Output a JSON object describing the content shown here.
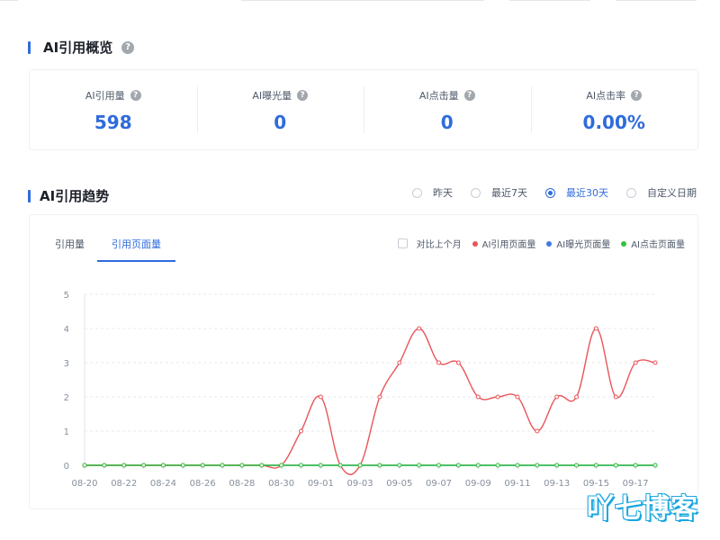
{
  "overview": {
    "title": "AI引用概览",
    "metrics": [
      {
        "label": "AI引用量",
        "value": "598"
      },
      {
        "label": "AI曝光量",
        "value": "0"
      },
      {
        "label": "AI点击量",
        "value": "0"
      },
      {
        "label": "AI点击率",
        "value": "0.00%"
      }
    ]
  },
  "trend": {
    "title": "AI引用趋势",
    "range_options": [
      {
        "label": "昨天",
        "selected": false
      },
      {
        "label": "最近7天",
        "selected": false
      },
      {
        "label": "最近30天",
        "selected": true
      },
      {
        "label": "自定义日期",
        "selected": false
      }
    ],
    "tabs": [
      {
        "label": "引用量",
        "active": false
      },
      {
        "label": "引用页面量",
        "active": true
      }
    ],
    "compare_label": "对比上个月",
    "legend": [
      {
        "name": "AI引用页面量",
        "color": "#e8555a"
      },
      {
        "name": "AI曝光页面量",
        "color": "#3f7ae0"
      },
      {
        "name": "AI点击页面量",
        "color": "#34c23a"
      }
    ]
  },
  "chart_data": {
    "type": "line",
    "x": [
      "08-20",
      "08-21",
      "08-22",
      "08-23",
      "08-24",
      "08-25",
      "08-26",
      "08-27",
      "08-28",
      "08-29",
      "08-30",
      "08-31",
      "09-01",
      "09-02",
      "09-03",
      "09-04",
      "09-05",
      "09-06",
      "09-07",
      "09-08",
      "09-09",
      "09-10",
      "09-11",
      "09-12",
      "09-13",
      "09-14",
      "09-15",
      "09-16",
      "09-17",
      "09-18"
    ],
    "x_tick_labels": [
      "08-20",
      "08-22",
      "08-24",
      "08-26",
      "08-28",
      "08-30",
      "09-01",
      "09-03",
      "09-05",
      "09-07",
      "09-09",
      "09-11",
      "09-13",
      "09-15",
      "09-17"
    ],
    "ylim": [
      0,
      5
    ],
    "y_ticks": [
      "0",
      "1",
      "2",
      "3",
      "4",
      "5"
    ],
    "grid": true,
    "series": [
      {
        "name": "AI引用页面量",
        "color": "#e8555a",
        "values": [
          0,
          0,
          0,
          0,
          0,
          0,
          0,
          0,
          0,
          0,
          0,
          1,
          2,
          0,
          0,
          2,
          3,
          4,
          3,
          3,
          2,
          2,
          2,
          1,
          2,
          2,
          4,
          2,
          3,
          3
        ]
      },
      {
        "name": "AI曝光页面量",
        "color": "#3f7ae0",
        "values": [
          0,
          0,
          0,
          0,
          0,
          0,
          0,
          0,
          0,
          0,
          0,
          0,
          0,
          0,
          0,
          0,
          0,
          0,
          0,
          0,
          0,
          0,
          0,
          0,
          0,
          0,
          0,
          0,
          0,
          0
        ]
      },
      {
        "name": "AI点击页面量",
        "color": "#34c23a",
        "values": [
          0,
          0,
          0,
          0,
          0,
          0,
          0,
          0,
          0,
          0,
          0,
          0,
          0,
          0,
          0,
          0,
          0,
          0,
          0,
          0,
          0,
          0,
          0,
          0,
          0,
          0,
          0,
          0,
          0,
          0
        ]
      }
    ]
  },
  "watermark": "吖七博客"
}
